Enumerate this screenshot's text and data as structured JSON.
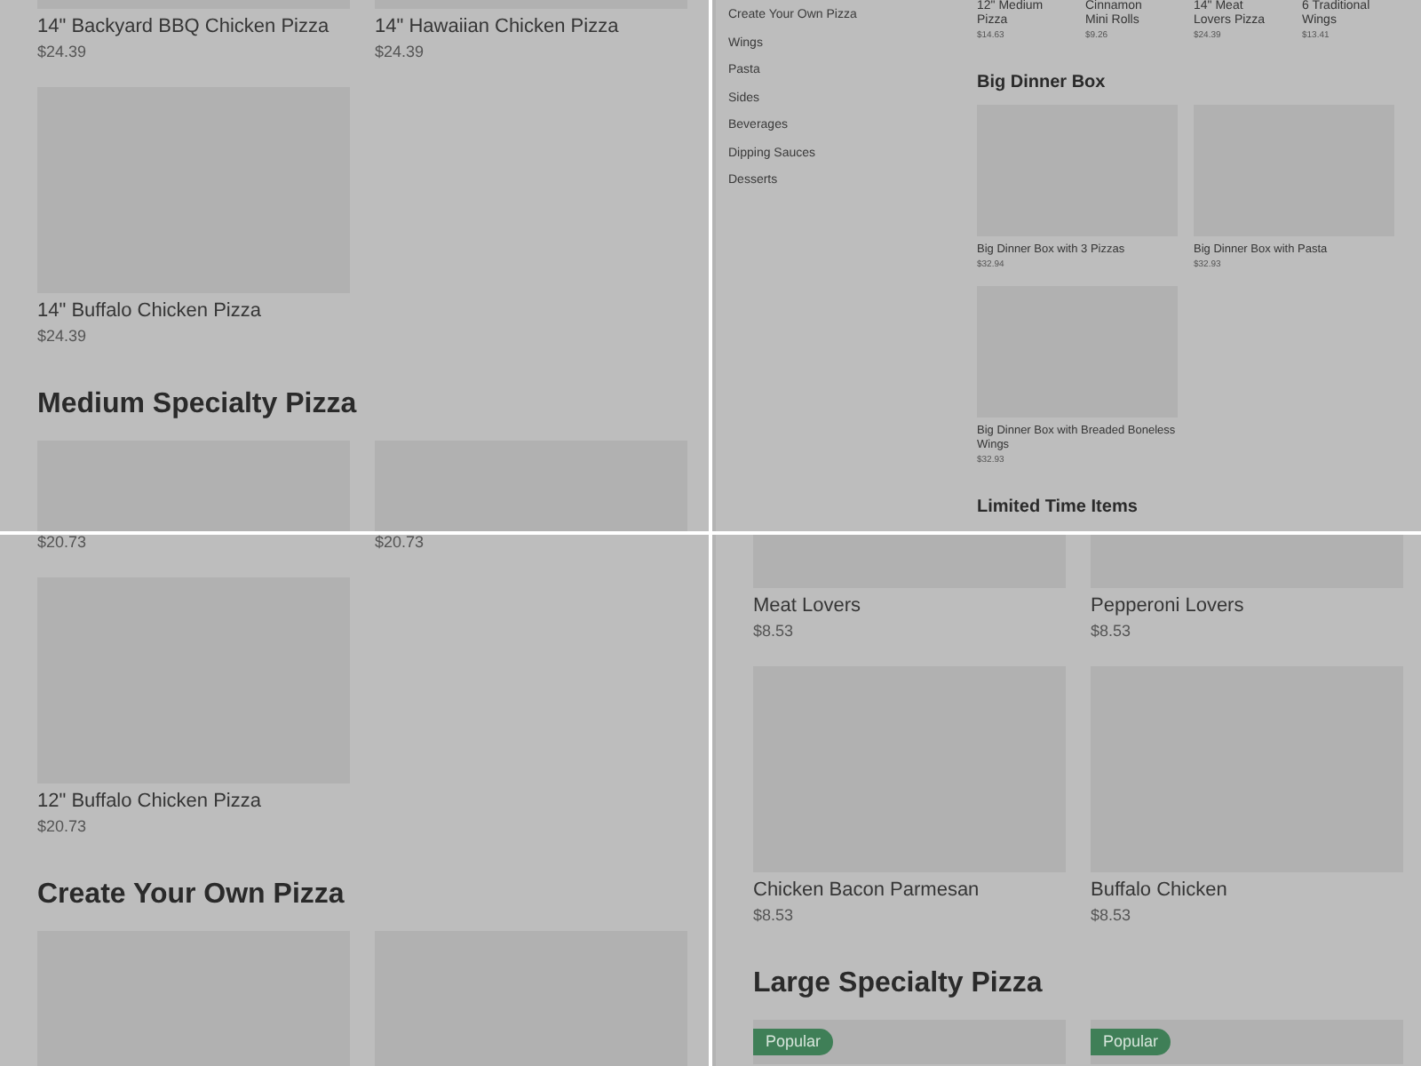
{
  "panels": [
    {
      "kind": "mobile",
      "blocks": [
        {
          "kind": "grid",
          "items": [
            {
              "kind": "card",
              "name": "14\" Backyard BBQ Chicken Pizza",
              "price": "$24.39"
            },
            {
              "kind": "card",
              "name": "14\" Hawaiian Chicken Pizza",
              "price": "$24.39"
            },
            {
              "kind": "card",
              "name": "14\" Buffalo Chicken Pizza",
              "price": "$24.39"
            }
          ]
        },
        {
          "kind": "heading",
          "text": "Medium Specialty Pizza"
        },
        {
          "kind": "grid",
          "items": [
            {
              "kind": "image_only"
            },
            {
              "kind": "image_only"
            }
          ]
        }
      ]
    },
    {
      "kind": "desktop",
      "sidebar": [
        "Create Your Own Pizza",
        "Wings",
        "Pasta",
        "Sides",
        "Beverages",
        "Dipping Sauces",
        "Desserts"
      ],
      "blocks": [
        {
          "kind": "compact_row",
          "items": [
            {
              "name": "12\" Medium Pizza",
              "price": "$14.63"
            },
            {
              "name": "Cinnamon Mini Rolls",
              "price": "$9.26"
            },
            {
              "name": "14\" Meat Lovers Pizza",
              "price": "$24.39"
            },
            {
              "name": "6 Traditional Wings",
              "price": "$13.41"
            }
          ]
        },
        {
          "kind": "heading",
          "text": "Big Dinner Box"
        },
        {
          "kind": "grid",
          "items": [
            {
              "kind": "card",
              "name": "Big Dinner Box with 3 Pizzas",
              "price": "$32.94"
            },
            {
              "kind": "card",
              "name": "Big Dinner Box with Pasta",
              "price": "$32.93"
            },
            {
              "kind": "card",
              "name": "Big Dinner Box with Breaded Boneless Wings",
              "price": "$32.93"
            }
          ]
        },
        {
          "kind": "heading",
          "text": "Limited Time Items"
        }
      ]
    },
    {
      "kind": "mobile",
      "blocks": [
        {
          "kind": "grid",
          "items": [
            {
              "kind": "card",
              "price": "$20.73"
            },
            {
              "kind": "card",
              "price": "$20.73"
            },
            {
              "kind": "card",
              "name": "12\" Buffalo Chicken Pizza",
              "price": "$20.73"
            }
          ]
        },
        {
          "kind": "heading",
          "text": "Create Your Own Pizza"
        },
        {
          "kind": "grid",
          "items": [
            {
              "kind": "image_only"
            },
            {
              "kind": "image_only"
            }
          ]
        }
      ]
    },
    {
      "kind": "mobile",
      "blocks": [
        {
          "kind": "grid",
          "items": [
            {
              "kind": "card",
              "name": "Meat Lovers",
              "price": "$8.53"
            },
            {
              "kind": "card",
              "name": "Pepperoni Lovers",
              "price": "$8.53"
            },
            {
              "kind": "card",
              "name": "Chicken Bacon Parmesan",
              "price": "$8.53"
            },
            {
              "kind": "card",
              "name": "Buffalo Chicken",
              "price": "$8.53"
            }
          ]
        },
        {
          "kind": "heading",
          "text": "Large Specialty Pizza"
        },
        {
          "kind": "grid",
          "items": [
            {
              "kind": "image_only",
              "badge": "Popular"
            },
            {
              "kind": "image_only",
              "badge": "Popular"
            }
          ]
        }
      ]
    }
  ]
}
